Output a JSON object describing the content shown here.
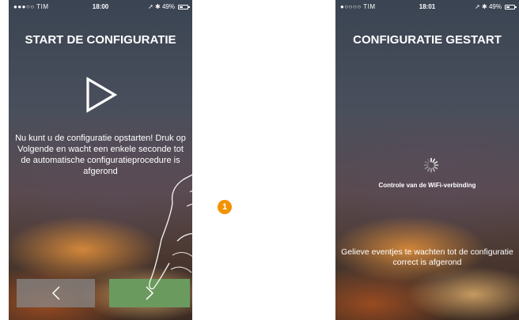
{
  "accent_color": "#f39200",
  "left_screen": {
    "status_bar": {
      "carrier": "●●●○○ TIM",
      "time": "18:00",
      "battery": "49%",
      "battery_level": 0.49
    },
    "title": "START DE CONFIGURATIE",
    "icon": "play-icon",
    "message": "Nu kunt u de configuratie opstarten! Druk op Volgende en wacht een enkele seconde tot de automatische configuratieprocedure is afgerond",
    "back_icon": "chevron-left-icon",
    "next_icon": "chevron-right-icon"
  },
  "right_screen": {
    "status_bar": {
      "carrier": "●○○○○ TIM",
      "time": "18:01",
      "battery": "49%",
      "battery_level": 0.49
    },
    "title": "CONFIGURATIE GESTART",
    "icon": "spinner-icon",
    "checking_text": "Controle van de WiFi-verbinding",
    "wait_message": "Gelieve eventjes te wachten tot de configuratie correct is afgerond"
  },
  "callout": {
    "number": "1"
  }
}
